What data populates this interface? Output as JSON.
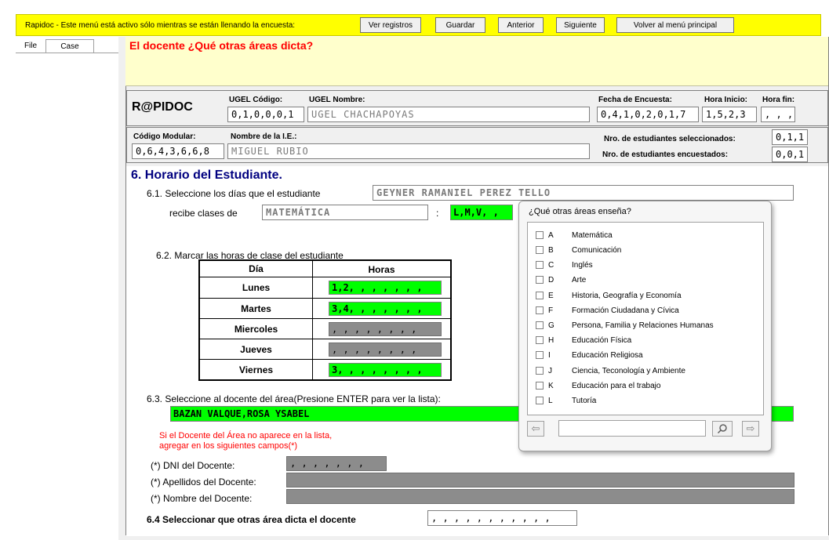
{
  "toolbar": {
    "notice": "Rapidoc - Este menú está activo sólo mientras se están llenando la encuesta:",
    "buttons": {
      "ver_registros": "Ver registros",
      "guardar": "Guardar",
      "anterior": "Anterior",
      "siguiente": "Siguiente",
      "volver": "Volver al menú principal"
    }
  },
  "left_tabs": {
    "file": "File",
    "case": "Case"
  },
  "question": "El docente ¿Qué otras áreas dicta?",
  "header": {
    "logo": "R@PIDOC",
    "ugel_codigo_label": "UGEL Código:",
    "ugel_codigo": "0,1,0,0,0,1",
    "ugel_nombre_label": "UGEL Nombre:",
    "ugel_nombre": "UGEL CHACHAPOYAS",
    "fecha_label": "Fecha de Encuesta:",
    "fecha": "0,4,1,0,2,0,1,7",
    "hora_inicio_label": "Hora Inicio:",
    "hora_inicio": "1,5,2,3",
    "hora_fin_label": "Hora fin:",
    "hora_fin": ", , ,",
    "codigo_modular_label": "Código Modular:",
    "codigo_modular": "0,6,4,3,6,6,8",
    "nombre_ie_label": "Nombre de la I.E.:",
    "nombre_ie": "MIGUEL RUBIO",
    "nro_seleccionados_label": "Nro. de estudiantes seleccionados:",
    "nro_seleccionados": "0,1,1",
    "nro_encuestados_label": "Nro. de estudiantes encuestados:",
    "nro_encuestados": "0,0,1"
  },
  "form": {
    "section_title": "6. Horario del Estudiante.",
    "q61_label": "6.1. Seleccione los días que el estudiante",
    "student_name": "GEYNER RAMANIEL PEREZ TELLO",
    "recibe_label": "recibe clases de",
    "subject": "MATEMÁTICA",
    "colon": ":",
    "days_value": "L,M,V, ,",
    "q62_label": "6.2. Marcar las horas de clase del estudiante",
    "table_headers": {
      "dia": "Día",
      "horas": "Horas"
    },
    "rows": [
      {
        "day": "Lunes",
        "hours": "1,2, , , , , , ,",
        "active": true
      },
      {
        "day": "Martes",
        "hours": "3,4, , , , , , ,",
        "active": true
      },
      {
        "day": "Miercoles",
        "hours": ", , , , , , , ,",
        "active": false
      },
      {
        "day": "Jueves",
        "hours": ", , , , , , , ,",
        "active": false
      },
      {
        "day": "Viernes",
        "hours": "3, , , , , , , ,",
        "active": true
      }
    ],
    "q63_label": "6.3. Seleccione al docente del área(Presione ENTER para ver la lista):",
    "teacher": "BAZAN VALQUE,ROSA YSABEL",
    "warning_line1": "Si el Docente del Área no aparece en la lista,",
    "warning_line2": "agregar en los siguientes campos(*)",
    "dni_label": "(*) DNI del Docente:",
    "dni_value": ", , , , , , ,",
    "apellidos_label": "(*) Apellidos del Docente:",
    "nombre_label": "(*) Nombre del Docente:",
    "q64_label": "6.4  Seleccionar que otras área dicta el docente",
    "q64_value": ", , , , , , , , , , ,"
  },
  "popup": {
    "title": "¿Qué otras áreas enseña?",
    "items": [
      {
        "letter": "A",
        "label": "Matemática"
      },
      {
        "letter": "B",
        "label": "Comunicación"
      },
      {
        "letter": "C",
        "label": "Inglés"
      },
      {
        "letter": "D",
        "label": "Arte"
      },
      {
        "letter": "E",
        "label": "Historia, Geografía y Economía"
      },
      {
        "letter": "F",
        "label": "Formación Ciudadana y Cívica"
      },
      {
        "letter": "G",
        "label": "Persona, Familia y Relaciones Humanas"
      },
      {
        "letter": "H",
        "label": "Educación Física"
      },
      {
        "letter": "I",
        "label": "Educación Religiosa"
      },
      {
        "letter": "J",
        "label": "Ciencia, Teconología y Ambiente"
      },
      {
        "letter": "K",
        "label": "Educación para el trabajo"
      },
      {
        "letter": "L",
        "label": "Tutoría"
      }
    ],
    "search_value": "",
    "icons": [
      "left-arrow-icon",
      "search-icon",
      "right-arrow-icon"
    ]
  },
  "colors": {
    "toolbar": "#ffff00",
    "question_bg": "#ffffcc",
    "question_text": "#ff0000",
    "section_title": "#000080",
    "active_field": "#00ff00",
    "inactive_field": "#8c8c8c"
  }
}
